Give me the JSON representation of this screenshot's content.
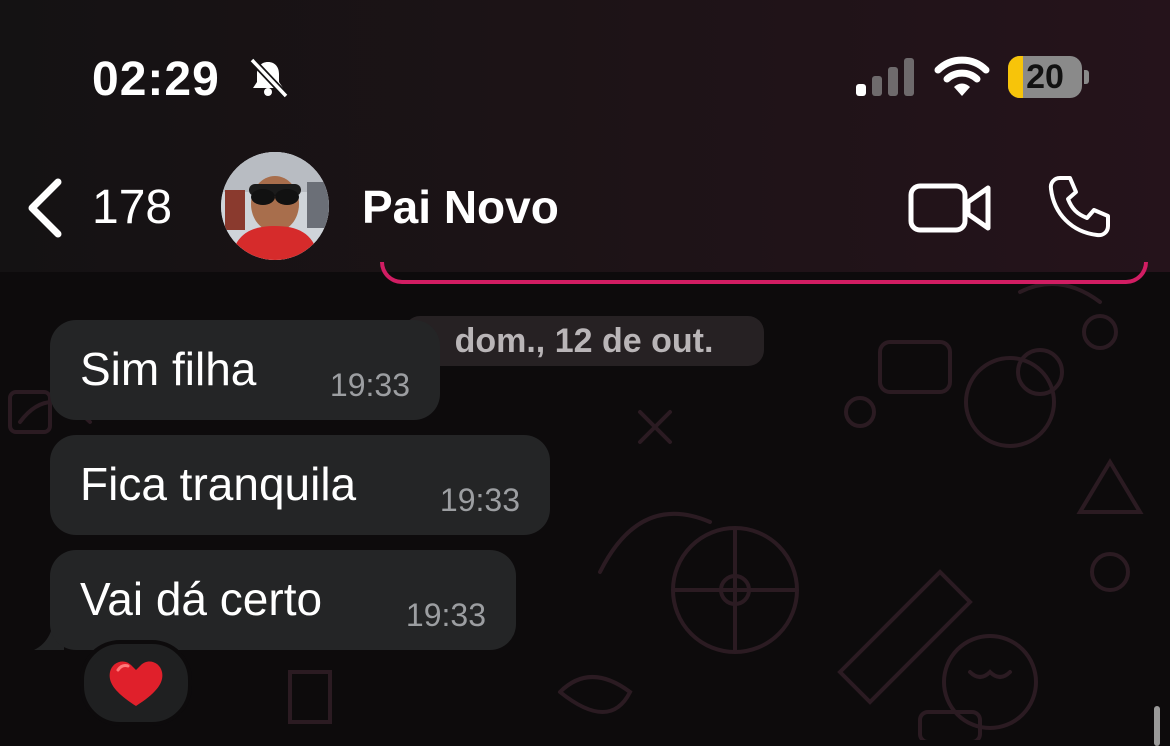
{
  "status_bar": {
    "time": "02:29",
    "battery": "20",
    "battery_level": 0.2
  },
  "header": {
    "back_count": "178",
    "contact_name": "Pai Novo"
  },
  "chat": {
    "date_separator": "dom., 12 de out.",
    "messages": [
      {
        "text": "Sim filha",
        "time": "19:33"
      },
      {
        "text": "Fica tranquila",
        "time": "19:33"
      },
      {
        "text": "Vai dá certo",
        "time": "19:33"
      }
    ],
    "reaction": "❤️"
  },
  "colors": {
    "accent_pink": "#d11d63",
    "bubble": "#242526",
    "battery_yellow": "#f7c40a"
  }
}
